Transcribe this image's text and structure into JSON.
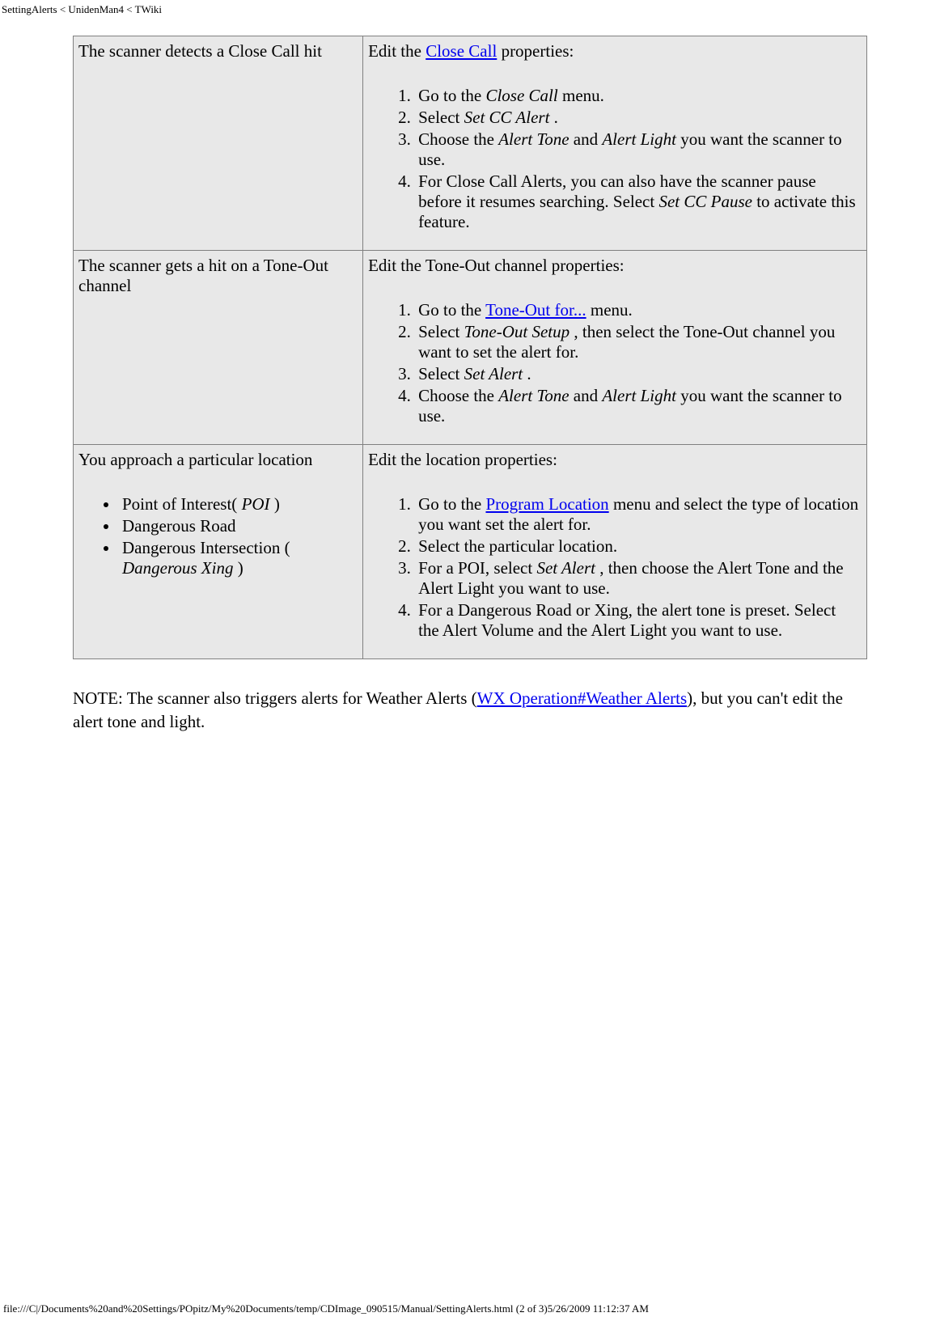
{
  "header": "SettingAlerts < UnidenMan4 < TWiki",
  "table": {
    "row1": {
      "left": "The scanner detects a Close Call hit",
      "right_intro_pre": "Edit the ",
      "right_intro_link": "Close Call",
      "right_intro_post": " properties:",
      "steps": {
        "s1_pre": "Go to the ",
        "s1_em": "Close Call",
        "s1_post": " menu.",
        "s2_pre": "Select ",
        "s2_em": "Set CC Alert",
        "s2_post": " .",
        "s3_pre": "Choose the ",
        "s3_em1": "Alert Tone",
        "s3_mid": " and ",
        "s3_em2": "Alert Light",
        "s3_post": " you want the scanner to use.",
        "s4_pre": "For Close Call Alerts, you can also have the scanner pause before it resumes searching. Select ",
        "s4_em": "Set CC Pause",
        "s4_post": " to activate this feature."
      }
    },
    "row2": {
      "left": "The scanner gets a hit on a Tone-Out channel",
      "right_intro": "Edit the Tone-Out channel properties:",
      "steps": {
        "s1_pre": "Go to the ",
        "s1_link": "Tone-Out for...",
        "s1_post": " menu.",
        "s2_pre": "Select ",
        "s2_em": "Tone-Out Setup",
        "s2_post": " , then select the Tone-Out channel you want to set the alert for.",
        "s3_pre": "Select ",
        "s3_em": "Set Alert",
        "s3_post": " .",
        "s4_pre": "Choose the ",
        "s4_em1": "Alert Tone",
        "s4_mid": " and ",
        "s4_em2": "Alert Light",
        "s4_post": " you want the scanner to use."
      }
    },
    "row3": {
      "left_intro": "You approach a particular location",
      "left_items": {
        "b1_pre": "Point of Interest( ",
        "b1_em": "POI",
        "b1_post": " )",
        "b2": "Dangerous Road",
        "b3_pre": "Dangerous Intersection ( ",
        "b3_em": "Dangerous Xing",
        "b3_post": " )"
      },
      "right_intro": "Edit the location properties:",
      "steps": {
        "s1_pre": "Go to the ",
        "s1_link": "Program Location",
        "s1_post": " menu and select the type of location you want set the alert for.",
        "s2": "Select the particular location.",
        "s3_pre": "For a POI, select ",
        "s3_em": "Set Alert",
        "s3_post": " , then choose the Alert Tone and the Alert Light you want to use.",
        "s4": "For a Dangerous Road or Xing, the alert tone is preset. Select the Alert Volume and the Alert Light you want to use."
      }
    }
  },
  "note": {
    "pre": "NOTE: The scanner also triggers alerts for Weather Alerts (",
    "link": "WX Operation#Weather Alerts",
    "post": "), but you can't edit the alert tone and light."
  },
  "footer": "file:///C|/Documents%20and%20Settings/POpitz/My%20Documents/temp/CDImage_090515/Manual/SettingAlerts.html (2 of 3)5/26/2009 11:12:37 AM"
}
